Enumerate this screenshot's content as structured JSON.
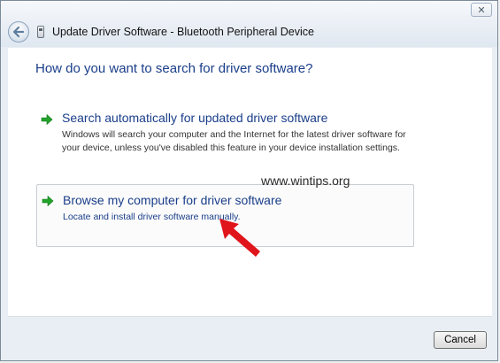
{
  "window": {
    "title": "Update Driver Software - Bluetooth Peripheral Device",
    "close_symbol": "✕"
  },
  "main": {
    "heading": "How do you want to search for driver software?",
    "options": [
      {
        "title": "Search automatically for updated driver software",
        "description": "Windows will search your computer and the Internet for the latest driver software for your device, unless you've disabled this feature in your device installation settings.",
        "icon": "green-arrow-icon"
      },
      {
        "title": "Browse my computer for driver software",
        "description": "Locate and install driver software manually.",
        "icon": "green-arrow-icon"
      }
    ],
    "watermark": "www.wintips.org"
  },
  "footer": {
    "cancel_label": "Cancel"
  },
  "colors": {
    "link_blue": "#1a3e8a",
    "arrow_green": "#22a32a",
    "annotation_red": "#e0141b"
  }
}
